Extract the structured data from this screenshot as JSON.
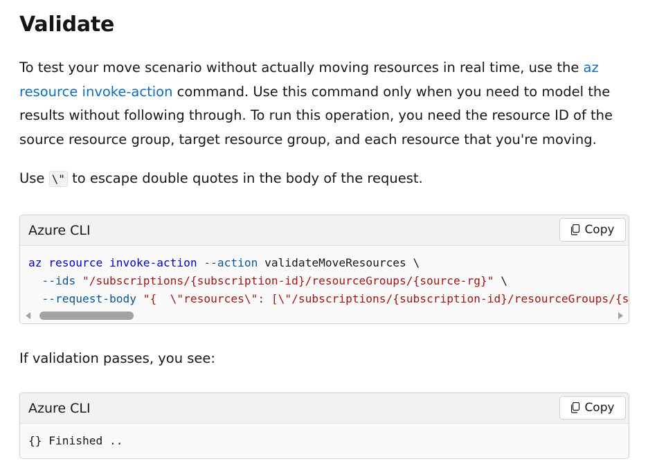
{
  "heading": "Validate",
  "para1": {
    "before": "To test your move scenario without actually moving resources in real time, use the ",
    "link": "az resource invoke-action",
    "after": " command. Use this command only when you need to model the results without following through. To run this operation, you need the resource ID of the source resource group, target resource group, and each resource that you're moving."
  },
  "para2": {
    "before": "Use ",
    "code": "\\\"",
    "after": " to escape double quotes in the body of the request."
  },
  "code1": {
    "language": "Azure CLI",
    "copy_label": "Copy",
    "line1": {
      "az": "az",
      "resource": "resource",
      "invoke": "invoke-action",
      "action_flag": "--action",
      "action_value": "validateMoveResources \\"
    },
    "line2": {
      "flag": "--ids",
      "value": "\"/subscriptions/{subscription-id}/resourceGroups/{source-rg}\"",
      "tail": " \\"
    },
    "line3": {
      "flag": "--request-body",
      "value": "\"{  \\\"resources\\\": [\\\"/subscriptions/{subscription-id}/resourceGroups/{source-rg}/providers/{resource-provider}/{resource-type}/{resource-name}\\\"], \\\"targetResourceGroup\\\":\\\"/subscriptions/{subscription-id}/resourceGroups/{destination-rg}\\\" }\""
    }
  },
  "para3": "If validation passes, you see:",
  "code2": {
    "language": "Azure CLI",
    "copy_label": "Copy",
    "output": "{} Finished .."
  },
  "icons": {
    "copy": "copy-icon",
    "scroll_left": "triangle-left-icon",
    "scroll_right": "triangle-right-icon"
  },
  "colors": {
    "link": "#0f6cbd",
    "keyword": "#0000cc",
    "string": "#a31515"
  }
}
